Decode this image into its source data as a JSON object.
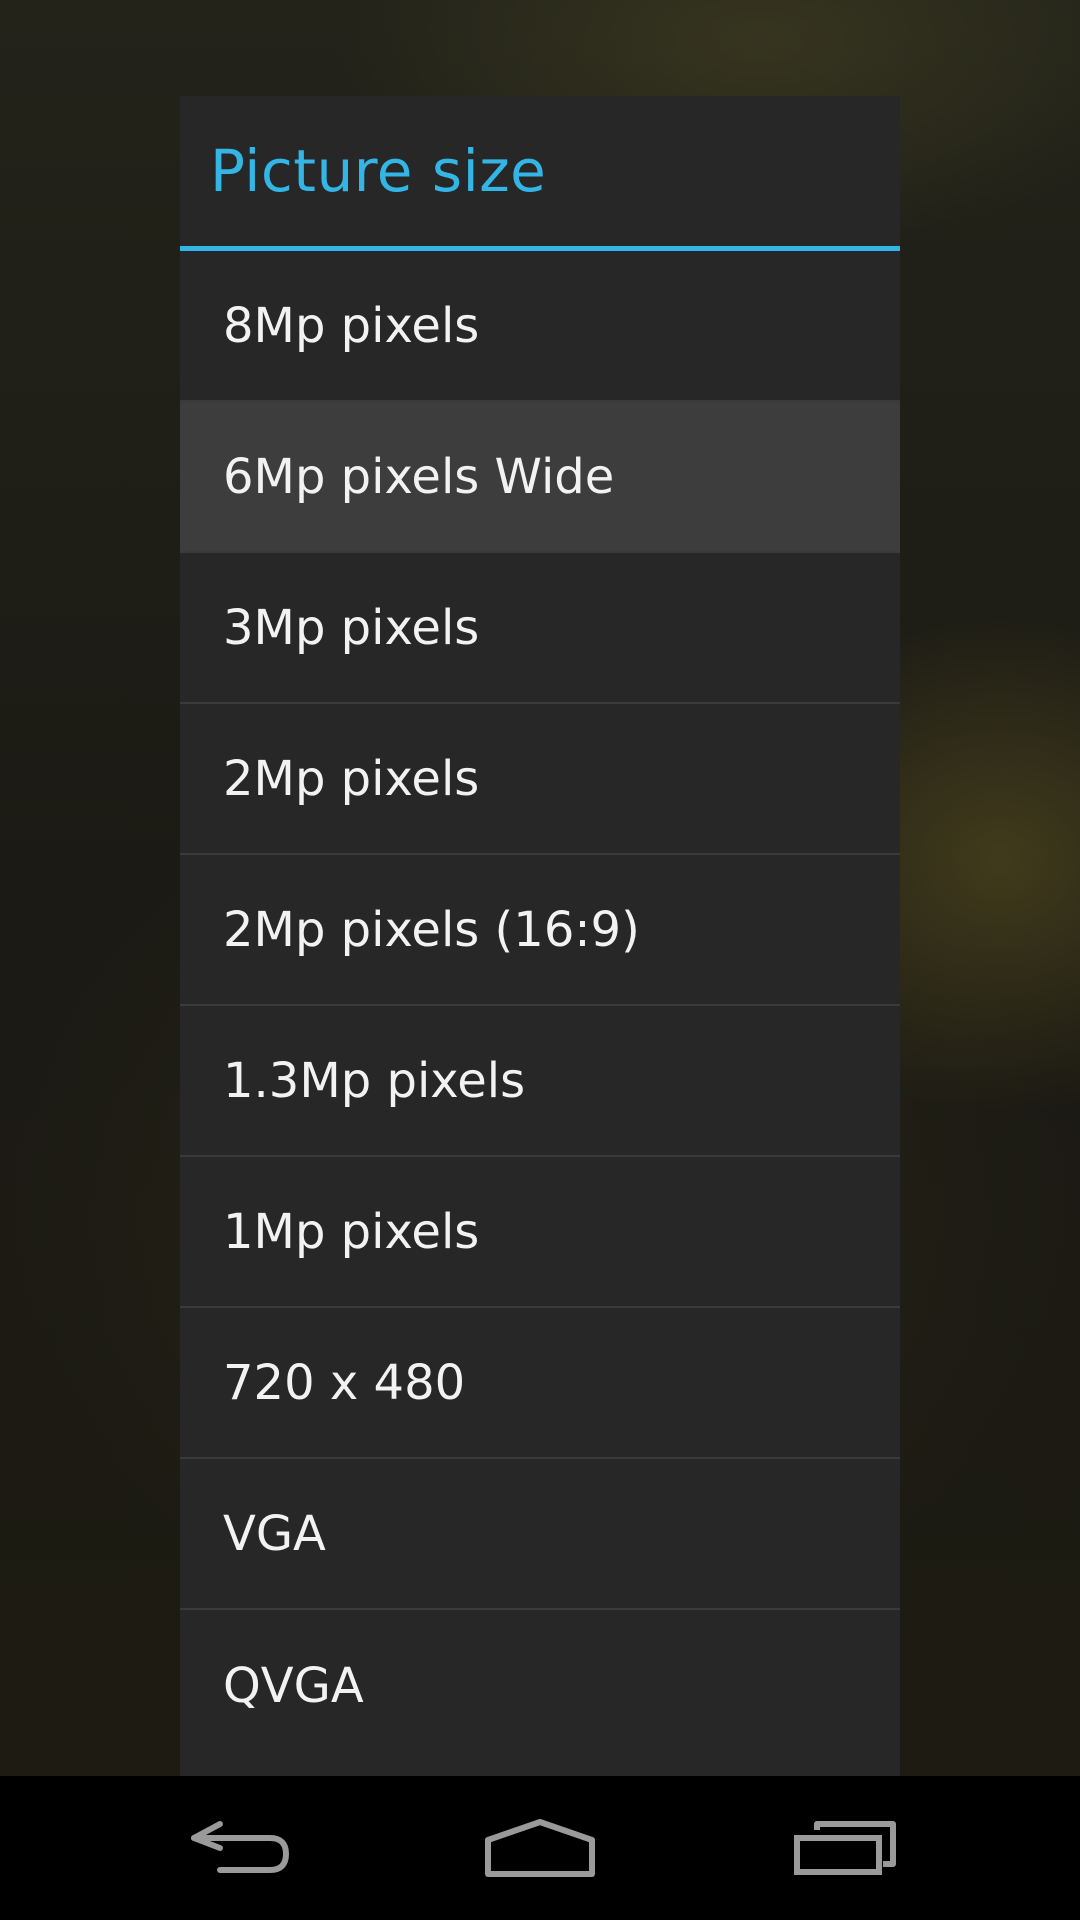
{
  "dialog": {
    "title": "Picture size",
    "accent_color": "#33b5e5",
    "pressed_index": 1,
    "options": [
      {
        "label": "8Mp pixels"
      },
      {
        "label": "6Mp pixels Wide"
      },
      {
        "label": "3Mp pixels"
      },
      {
        "label": "2Mp pixels"
      },
      {
        "label": "2Mp pixels (16:9)"
      },
      {
        "label": "1.3Mp pixels"
      },
      {
        "label": "1Mp pixels"
      },
      {
        "label": "720 x 480"
      },
      {
        "label": "VGA"
      },
      {
        "label": "QVGA"
      }
    ]
  },
  "navigation_bar": {
    "buttons": [
      {
        "icon": "back-icon"
      },
      {
        "icon": "home-icon"
      },
      {
        "icon": "recent-apps-icon"
      }
    ]
  }
}
